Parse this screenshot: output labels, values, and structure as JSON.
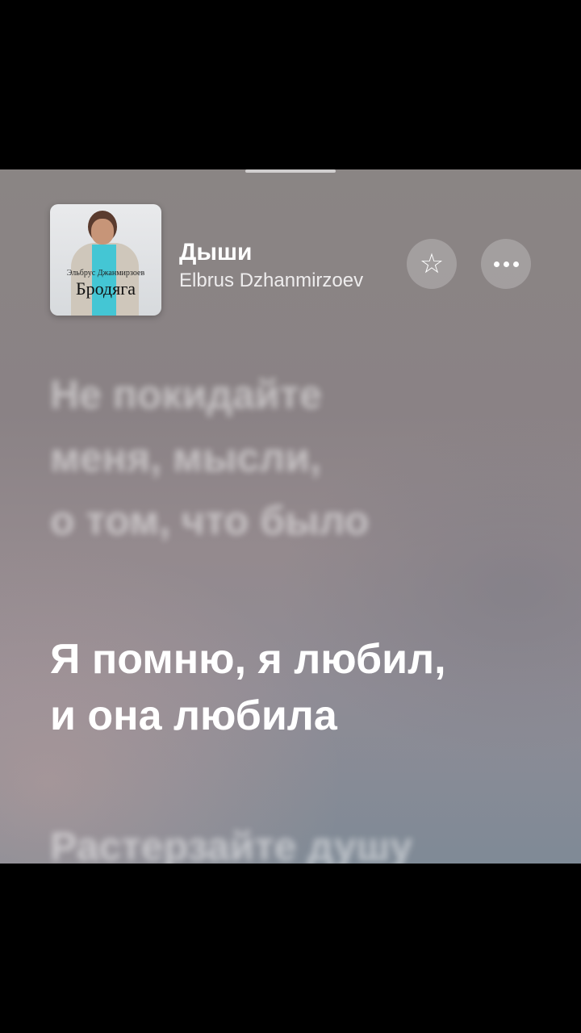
{
  "player": {
    "album_art": {
      "caption_small": "Эльбрус Джанмирзоев",
      "caption_big": "Бродяга"
    },
    "track": {
      "title": "Дыши",
      "artist": "Elbrus Dzhanmirzoev"
    },
    "buttons": {
      "favorite_icon": "star-icon",
      "more_icon": "ellipsis-icon"
    }
  },
  "lyrics": {
    "previous": [
      "Не покидайте",
      "меня, мысли,",
      "о том, что было"
    ],
    "current": [
      "Я помню, я любил,",
      "и она любила"
    ],
    "next": [
      "Растерзайте душу"
    ]
  }
}
